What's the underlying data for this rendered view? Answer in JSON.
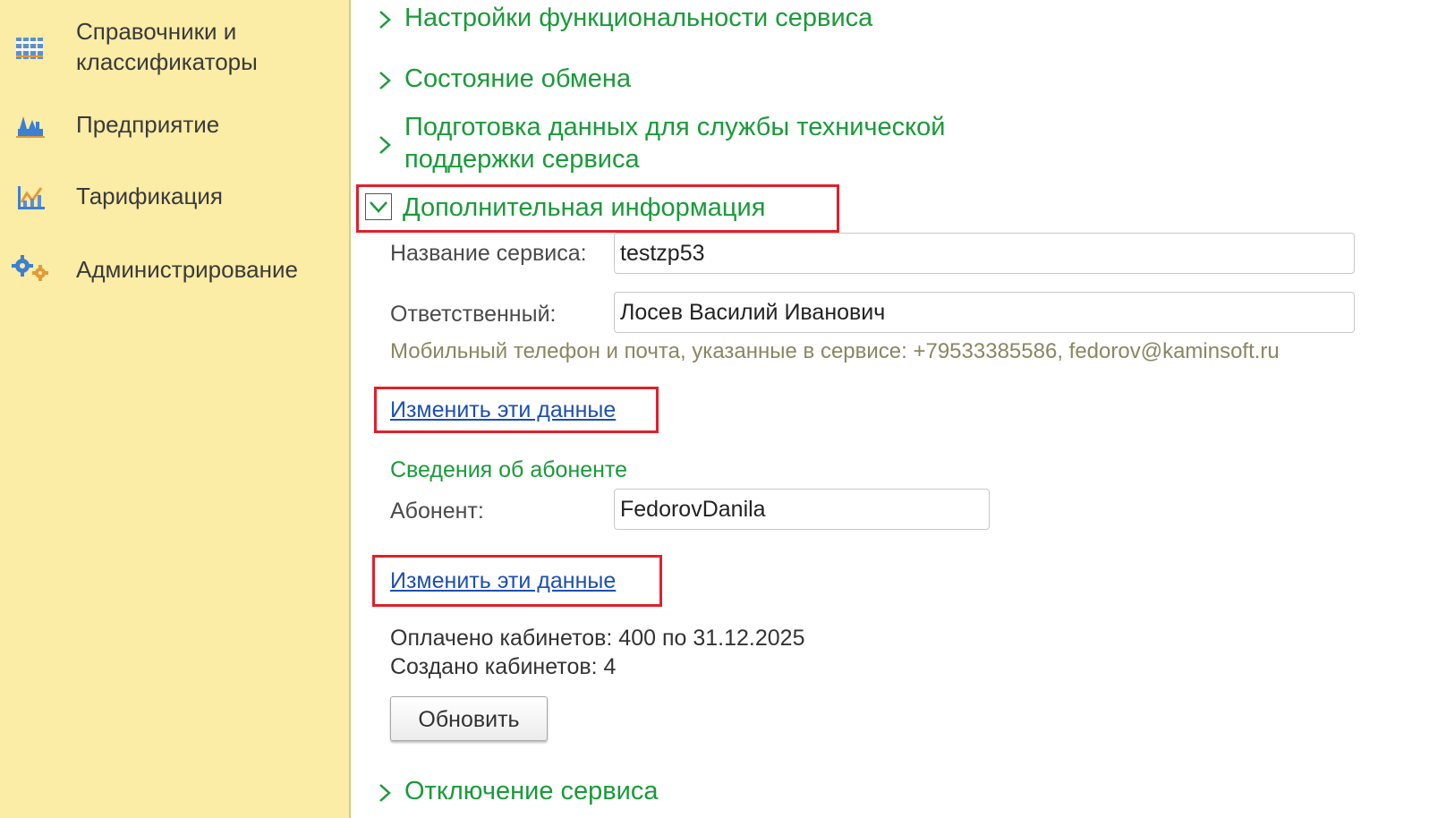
{
  "sidebar": {
    "items": [
      {
        "label": "Справочники и классификаторы",
        "icon": "directories-icon"
      },
      {
        "label": "Предприятие",
        "icon": "factory-icon"
      },
      {
        "label": "Тарификация",
        "icon": "chart-icon"
      },
      {
        "label": "Администрирование",
        "icon": "gears-icon"
      }
    ]
  },
  "sections": {
    "s1": "Настройки функциональности сервиса",
    "s2": "Состояние обмена",
    "s3": "Подготовка данных для службы технической поддержки сервиса",
    "s4": "Дополнительная информация",
    "s5": "Отключение сервиса"
  },
  "details": {
    "service_name_label": "Название сервиса:",
    "service_name_value": "testzp53",
    "responsible_label": "Ответственный:",
    "responsible_value": "Лосев Василий Иванович",
    "contact_hint": "Мобильный телефон и почта, указанные в сервисе: +79533385586, fedorov@kaminsoft.ru",
    "change_link_1": "Изменить эти данные",
    "subscriber_header": "Сведения об абоненте",
    "subscriber_label": "Абонент:",
    "subscriber_value": "FedorovDanila",
    "change_link_2": "Изменить эти данные",
    "paid_cabinets": "Оплачено кабинетов: 400 по 31.12.2025",
    "created_cabinets": "Создано кабинетов: 4",
    "refresh_button": "Обновить"
  },
  "colors": {
    "sidebar_bg": "#fbeca6",
    "section_green": "#1a9a3a",
    "link_blue": "#1d4fb0",
    "highlight_red": "#e0202a"
  }
}
